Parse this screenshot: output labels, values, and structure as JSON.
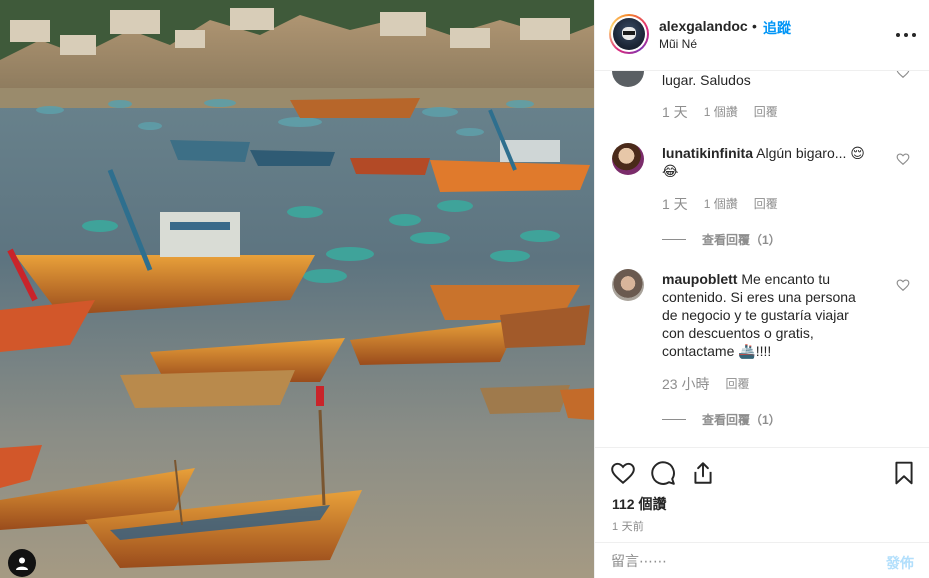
{
  "post": {
    "username": "alexgalandoc",
    "follow_separator": "•",
    "follow_label": "追蹤",
    "location": "Mũi Né"
  },
  "comments": [
    {
      "username": "",
      "text": "lugar. Saludos",
      "time": "1 天",
      "likes": "1 個讚",
      "reply_label": "回覆"
    },
    {
      "username": "lunatikinfinita",
      "text": "Algún bigaro... 😌😂",
      "time": "1 天",
      "likes": "1 個讚",
      "reply_label": "回覆",
      "view_replies": "查看回覆（1）"
    },
    {
      "username": "maupoblett",
      "text": "Me encanto tu contenido. Si eres una persona de negocio y te gustaría viajar con descuentos o gratis, contactame 🚢!!!!",
      "time": "23 小時",
      "reply_label": "回覆",
      "view_replies": "查看回覆（1）"
    }
  ],
  "actions": {
    "like_icon": "heart-icon",
    "comment_icon": "comment-icon",
    "share_icon": "share-icon",
    "save_icon": "bookmark-icon",
    "likes_count": "112 個讚",
    "posted_ago": "1 天前"
  },
  "comment_box": {
    "placeholder": "留言⋯⋯",
    "post_label": "發佈"
  },
  "colors": {
    "accent": "#0095f6",
    "post_disabled": "#b2dffc",
    "secondary_text": "#8e8e8e",
    "border": "#efefef"
  }
}
